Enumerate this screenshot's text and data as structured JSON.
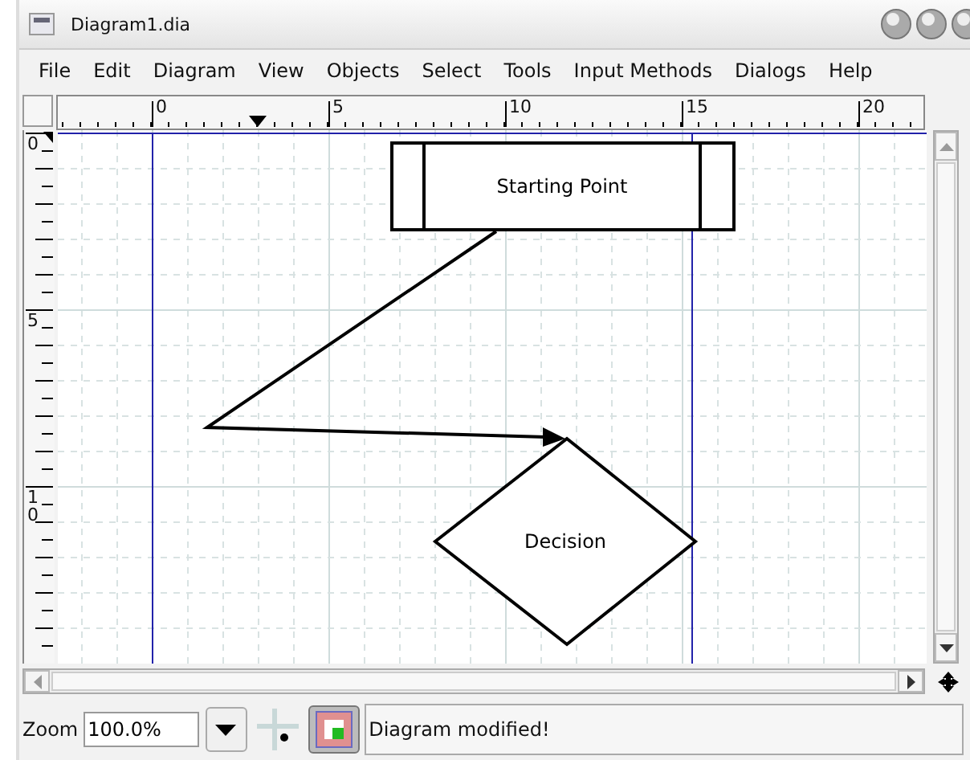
{
  "window": {
    "title": "Diagram1.dia"
  },
  "menu": [
    "File",
    "Edit",
    "Diagram",
    "View",
    "Objects",
    "Select",
    "Tools",
    "Input Methods",
    "Dialogs",
    "Help"
  ],
  "rulers": {
    "horizontal": [
      "0",
      "5",
      "10",
      "15",
      "20"
    ],
    "vertical": [
      "0",
      "5",
      "10"
    ]
  },
  "canvas": {
    "shapes": [
      {
        "kind": "process",
        "label": "Starting Point"
      },
      {
        "kind": "decision",
        "label": "Decision"
      }
    ]
  },
  "status_bar": {
    "zoom_label": "Zoom",
    "zoom_value": "100.0%",
    "snap_to_grid": false,
    "object_snap": true,
    "message": "Diagram modified!"
  }
}
